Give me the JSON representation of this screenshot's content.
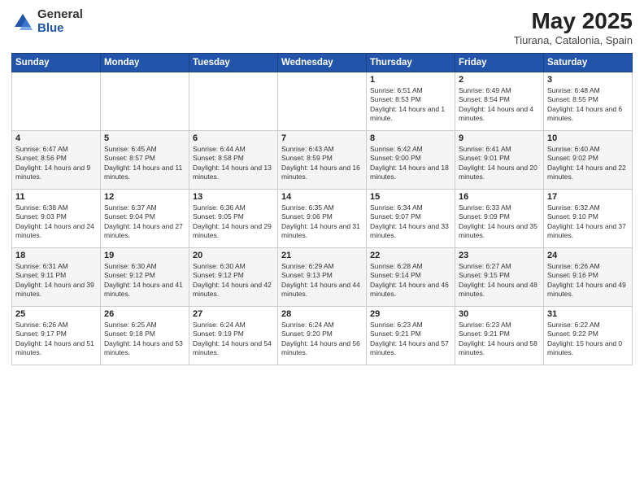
{
  "logo": {
    "general": "General",
    "blue": "Blue"
  },
  "title": {
    "main": "May 2025",
    "sub": "Tiurana, Catalonia, Spain"
  },
  "headers": [
    "Sunday",
    "Monday",
    "Tuesday",
    "Wednesday",
    "Thursday",
    "Friday",
    "Saturday"
  ],
  "weeks": [
    [
      {
        "day": "",
        "info": ""
      },
      {
        "day": "",
        "info": ""
      },
      {
        "day": "",
        "info": ""
      },
      {
        "day": "",
        "info": ""
      },
      {
        "day": "1",
        "info": "Sunrise: 6:51 AM\nSunset: 8:53 PM\nDaylight: 14 hours and 1 minute."
      },
      {
        "day": "2",
        "info": "Sunrise: 6:49 AM\nSunset: 8:54 PM\nDaylight: 14 hours and 4 minutes."
      },
      {
        "day": "3",
        "info": "Sunrise: 6:48 AM\nSunset: 8:55 PM\nDaylight: 14 hours and 6 minutes."
      }
    ],
    [
      {
        "day": "4",
        "info": "Sunrise: 6:47 AM\nSunset: 8:56 PM\nDaylight: 14 hours and 9 minutes."
      },
      {
        "day": "5",
        "info": "Sunrise: 6:45 AM\nSunset: 8:57 PM\nDaylight: 14 hours and 11 minutes."
      },
      {
        "day": "6",
        "info": "Sunrise: 6:44 AM\nSunset: 8:58 PM\nDaylight: 14 hours and 13 minutes."
      },
      {
        "day": "7",
        "info": "Sunrise: 6:43 AM\nSunset: 8:59 PM\nDaylight: 14 hours and 16 minutes."
      },
      {
        "day": "8",
        "info": "Sunrise: 6:42 AM\nSunset: 9:00 PM\nDaylight: 14 hours and 18 minutes."
      },
      {
        "day": "9",
        "info": "Sunrise: 6:41 AM\nSunset: 9:01 PM\nDaylight: 14 hours and 20 minutes."
      },
      {
        "day": "10",
        "info": "Sunrise: 6:40 AM\nSunset: 9:02 PM\nDaylight: 14 hours and 22 minutes."
      }
    ],
    [
      {
        "day": "11",
        "info": "Sunrise: 6:38 AM\nSunset: 9:03 PM\nDaylight: 14 hours and 24 minutes."
      },
      {
        "day": "12",
        "info": "Sunrise: 6:37 AM\nSunset: 9:04 PM\nDaylight: 14 hours and 27 minutes."
      },
      {
        "day": "13",
        "info": "Sunrise: 6:36 AM\nSunset: 9:05 PM\nDaylight: 14 hours and 29 minutes."
      },
      {
        "day": "14",
        "info": "Sunrise: 6:35 AM\nSunset: 9:06 PM\nDaylight: 14 hours and 31 minutes."
      },
      {
        "day": "15",
        "info": "Sunrise: 6:34 AM\nSunset: 9:07 PM\nDaylight: 14 hours and 33 minutes."
      },
      {
        "day": "16",
        "info": "Sunrise: 6:33 AM\nSunset: 9:09 PM\nDaylight: 14 hours and 35 minutes."
      },
      {
        "day": "17",
        "info": "Sunrise: 6:32 AM\nSunset: 9:10 PM\nDaylight: 14 hours and 37 minutes."
      }
    ],
    [
      {
        "day": "18",
        "info": "Sunrise: 6:31 AM\nSunset: 9:11 PM\nDaylight: 14 hours and 39 minutes."
      },
      {
        "day": "19",
        "info": "Sunrise: 6:30 AM\nSunset: 9:12 PM\nDaylight: 14 hours and 41 minutes."
      },
      {
        "day": "20",
        "info": "Sunrise: 6:30 AM\nSunset: 9:12 PM\nDaylight: 14 hours and 42 minutes."
      },
      {
        "day": "21",
        "info": "Sunrise: 6:29 AM\nSunset: 9:13 PM\nDaylight: 14 hours and 44 minutes."
      },
      {
        "day": "22",
        "info": "Sunrise: 6:28 AM\nSunset: 9:14 PM\nDaylight: 14 hours and 46 minutes."
      },
      {
        "day": "23",
        "info": "Sunrise: 6:27 AM\nSunset: 9:15 PM\nDaylight: 14 hours and 48 minutes."
      },
      {
        "day": "24",
        "info": "Sunrise: 6:26 AM\nSunset: 9:16 PM\nDaylight: 14 hours and 49 minutes."
      }
    ],
    [
      {
        "day": "25",
        "info": "Sunrise: 6:26 AM\nSunset: 9:17 PM\nDaylight: 14 hours and 51 minutes."
      },
      {
        "day": "26",
        "info": "Sunrise: 6:25 AM\nSunset: 9:18 PM\nDaylight: 14 hours and 53 minutes."
      },
      {
        "day": "27",
        "info": "Sunrise: 6:24 AM\nSunset: 9:19 PM\nDaylight: 14 hours and 54 minutes."
      },
      {
        "day": "28",
        "info": "Sunrise: 6:24 AM\nSunset: 9:20 PM\nDaylight: 14 hours and 56 minutes."
      },
      {
        "day": "29",
        "info": "Sunrise: 6:23 AM\nSunset: 9:21 PM\nDaylight: 14 hours and 57 minutes."
      },
      {
        "day": "30",
        "info": "Sunrise: 6:23 AM\nSunset: 9:21 PM\nDaylight: 14 hours and 58 minutes."
      },
      {
        "day": "31",
        "info": "Sunrise: 6:22 AM\nSunset: 9:22 PM\nDaylight: 15 hours and 0 minutes."
      }
    ]
  ]
}
